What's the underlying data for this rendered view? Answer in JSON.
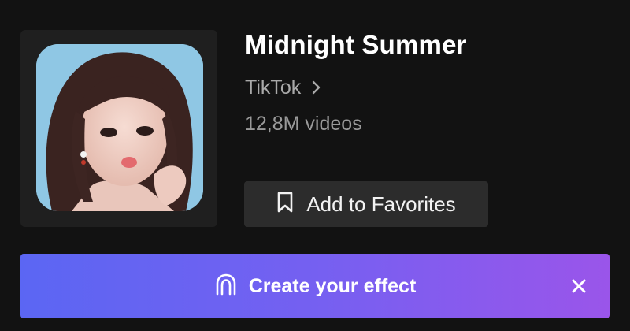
{
  "effect": {
    "title": "Midnight Summer",
    "author": "TikTok",
    "video_count": "12,8M videos",
    "thumbnail_alt": "Effect preview"
  },
  "actions": {
    "favorites_label": "Add to Favorites"
  },
  "banner": {
    "cta_label": "Create your effect"
  },
  "icons": {
    "author_chevron": "chevron-right-icon",
    "favorites": "bookmark-icon",
    "create": "arch-icon",
    "close": "close-icon"
  },
  "colors": {
    "background": "#121212",
    "button": "#2c2c2c",
    "banner_start": "#5b66f3",
    "banner_end": "#9a55ea"
  }
}
